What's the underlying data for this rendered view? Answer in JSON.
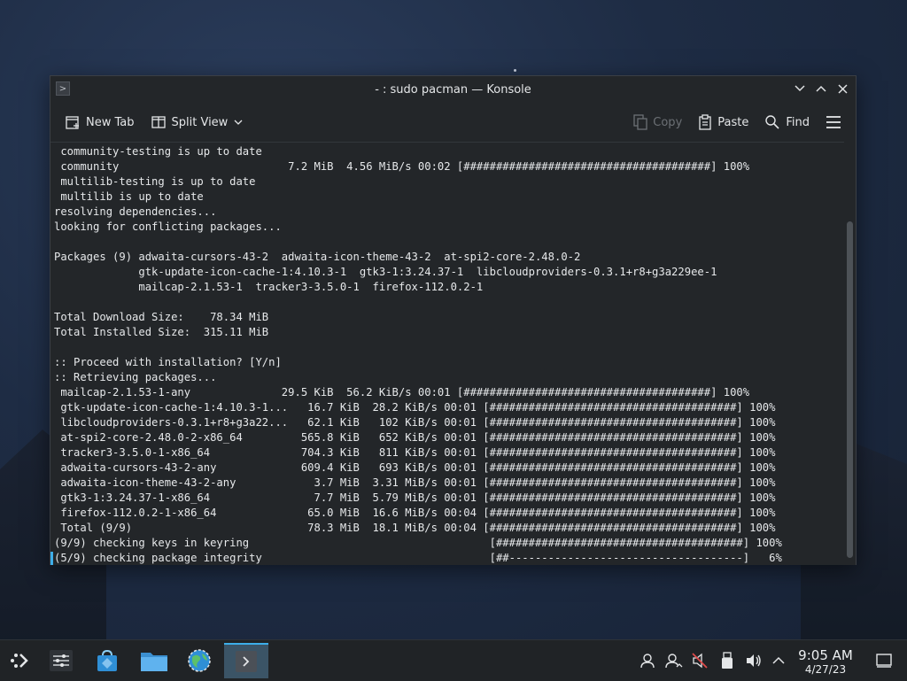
{
  "window": {
    "title": "- : sudo pacman — Konsole",
    "app_icon_glyph": ">"
  },
  "toolbar": {
    "new_tab_label": "New Tab",
    "split_view_label": "Split View",
    "copy_label": "Copy",
    "paste_label": "Paste",
    "find_label": "Find"
  },
  "terminal": {
    "lines": [
      " community-testing is up to date",
      " community                          7.2 MiB  4.56 MiB/s 00:02 [######################################] 100%",
      " multilib-testing is up to date",
      " multilib is up to date",
      "resolving dependencies...",
      "looking for conflicting packages...",
      "",
      "Packages (9) adwaita-cursors-43-2  adwaita-icon-theme-43-2  at-spi2-core-2.48.0-2",
      "             gtk-update-icon-cache-1:4.10.3-1  gtk3-1:3.24.37-1  libcloudproviders-0.3.1+r8+g3a229ee-1",
      "             mailcap-2.1.53-1  tracker3-3.5.0-1  firefox-112.0.2-1",
      "",
      "Total Download Size:    78.34 MiB",
      "Total Installed Size:  315.11 MiB",
      "",
      ":: Proceed with installation? [Y/n]",
      ":: Retrieving packages...",
      " mailcap-2.1.53-1-any              29.5 KiB  56.2 KiB/s 00:01 [######################################] 100%",
      " gtk-update-icon-cache-1:4.10.3-1...   16.7 KiB  28.2 KiB/s 00:01 [######################################] 100%",
      " libcloudproviders-0.3.1+r8+g3a22...   62.1 KiB   102 KiB/s 00:01 [######################################] 100%",
      " at-spi2-core-2.48.0-2-x86_64         565.8 KiB   652 KiB/s 00:01 [######################################] 100%",
      " tracker3-3.5.0-1-x86_64              704.3 KiB   811 KiB/s 00:01 [######################################] 100%",
      " adwaita-cursors-43-2-any             609.4 KiB   693 KiB/s 00:01 [######################################] 100%",
      " adwaita-icon-theme-43-2-any            3.7 MiB  3.31 MiB/s 00:01 [######################################] 100%",
      " gtk3-1:3.24.37-1-x86_64                7.7 MiB  5.79 MiB/s 00:01 [######################################] 100%",
      " firefox-112.0.2-1-x86_64              65.0 MiB  16.6 MiB/s 00:04 [######################################] 100%",
      " Total (9/9)                           78.3 MiB  18.1 MiB/s 00:04 [######################################] 100%",
      "(9/9) checking keys in keyring                                     [######################################] 100%",
      "(5/9) checking package integrity                                   [##------------------------------------]   6%"
    ]
  },
  "taskbar": {
    "clock_time": "9:05 AM",
    "clock_date": "4/27/23",
    "apps": [
      "application-launcher-icon",
      "system-settings-icon",
      "discover-store-icon",
      "file-manager-icon",
      "web-browser-icon",
      "konsole-icon"
    ]
  },
  "colors": {
    "accent": "#3daee9",
    "window_bg": "#232629",
    "taskbar_bg": "#202326",
    "text": "#e6e8ea"
  }
}
